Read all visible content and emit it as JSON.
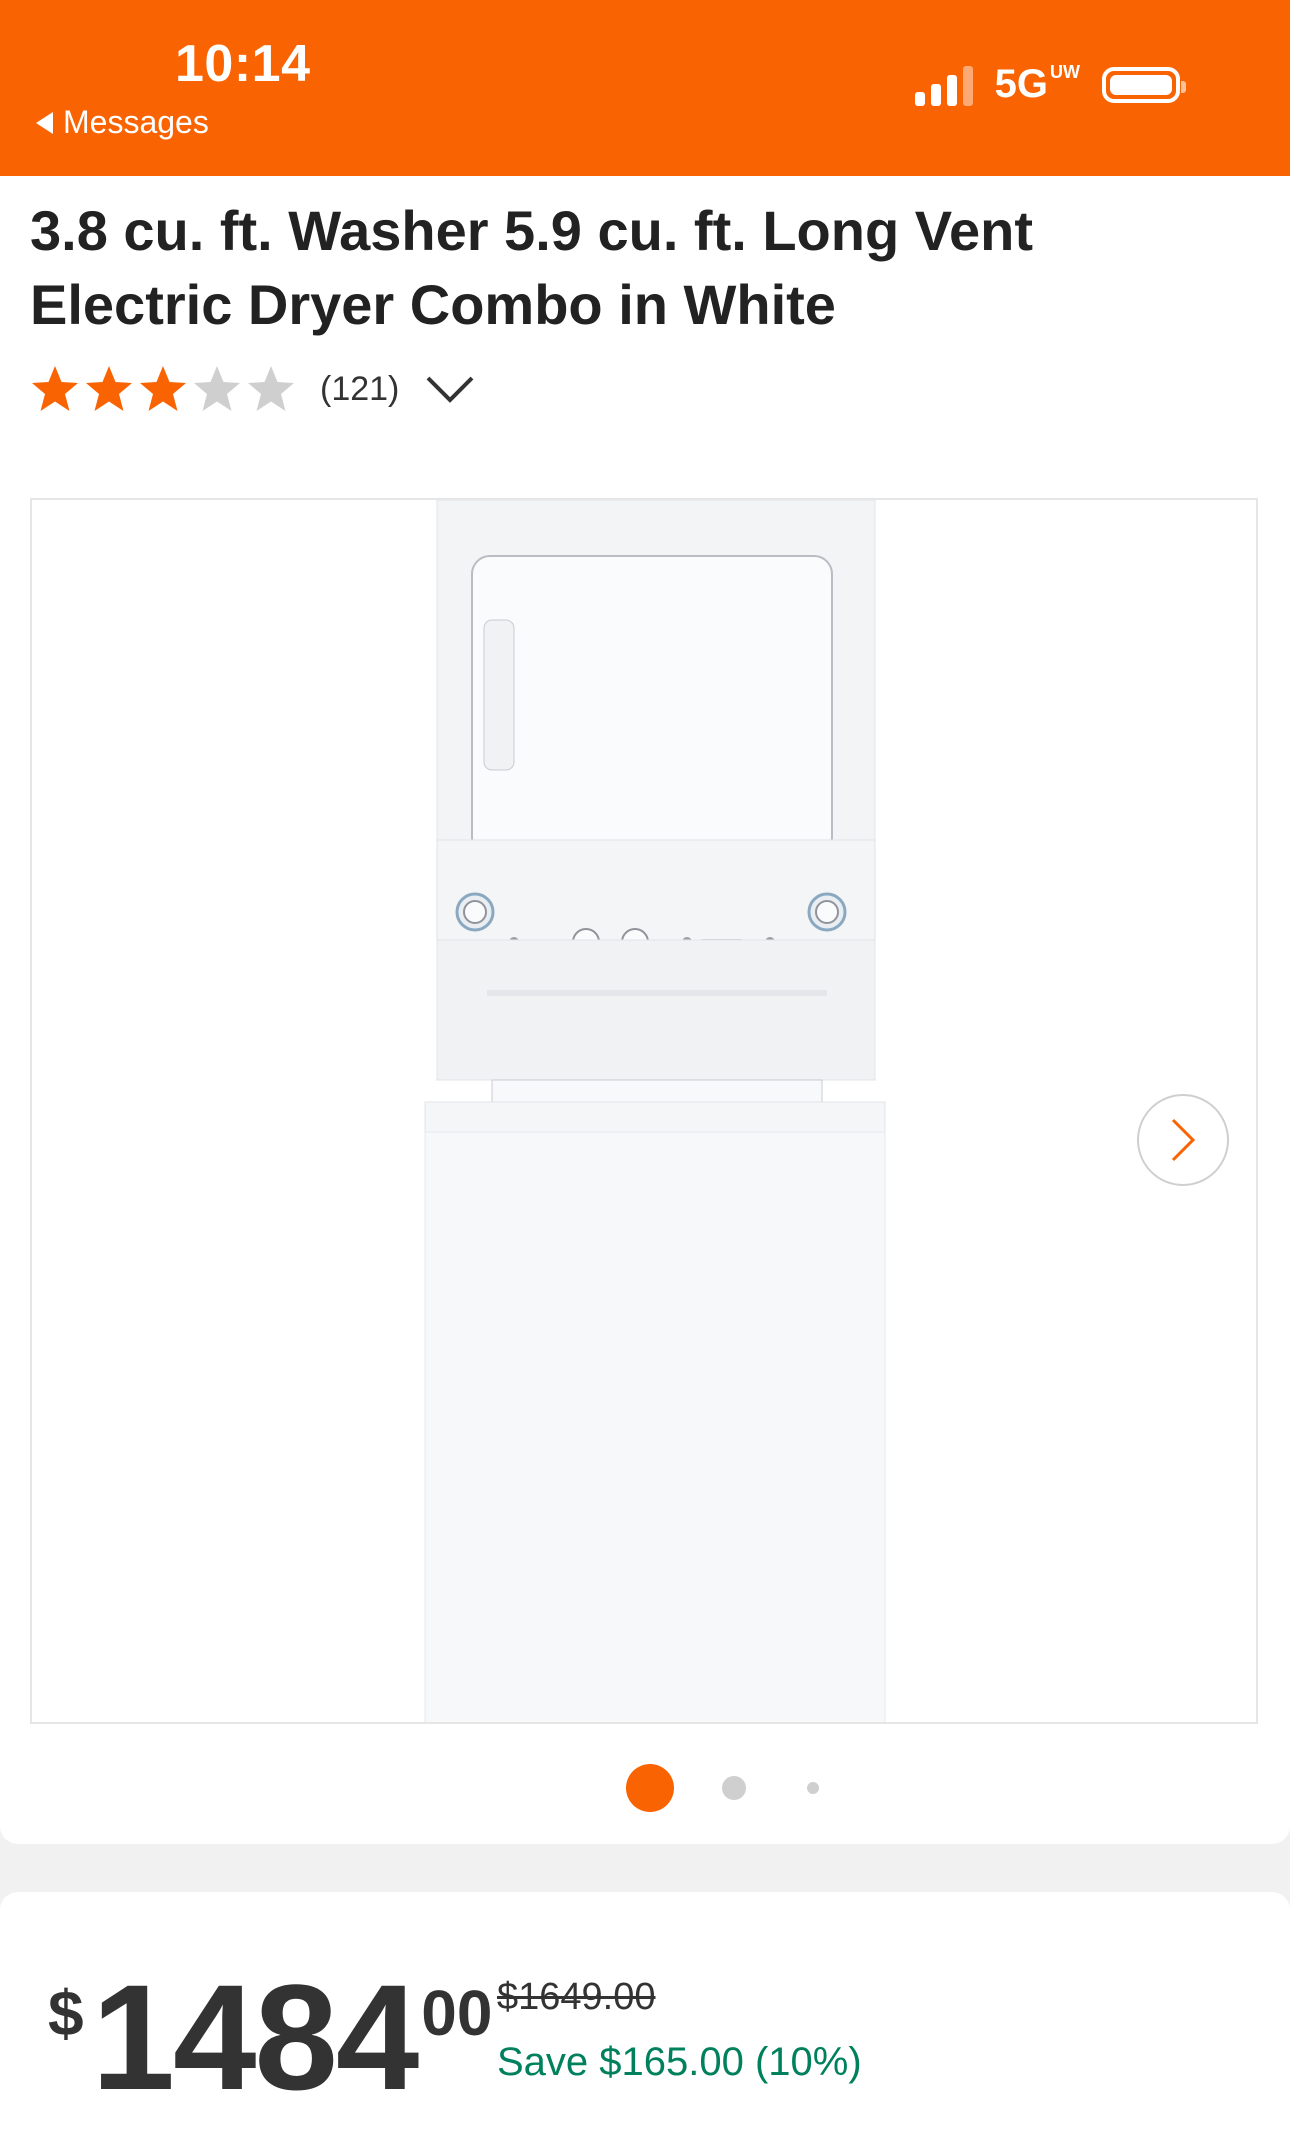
{
  "status_bar": {
    "time": "10:14",
    "back_label": "Messages",
    "network": "5G",
    "network_badge": "UW"
  },
  "product": {
    "title": "3.8 cu. ft. Washer 5.9 cu. ft. Long Vent Electric Dryer Combo in White",
    "rating": 3,
    "rating_max": 5,
    "review_count": "(121)"
  },
  "gallery": {
    "image_icon": "washer-dryer-combo-image",
    "next_icon": "chevron-right-icon",
    "active_index": 0,
    "total_images": 3
  },
  "pricing": {
    "currency": "$",
    "whole": "1484",
    "cents": "00",
    "was_price": "$1649.00",
    "savings": "Save $165.00 (10%)"
  },
  "colors": {
    "brand": "#f96302",
    "star_filled": "#f96302",
    "star_empty": "#cfcfcf",
    "savings": "#00805c"
  }
}
